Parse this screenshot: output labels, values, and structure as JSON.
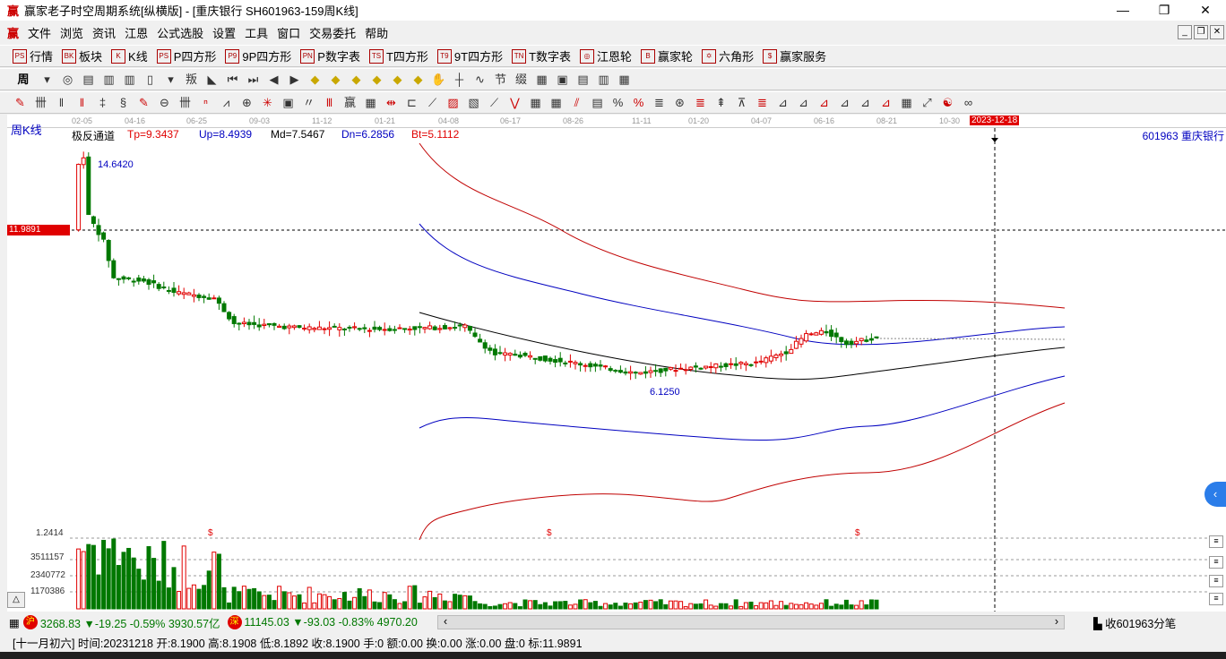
{
  "title": "赢家老子时空周期系统[纵横版] - [重庆银行  SH601963-159周K线]",
  "logo": "赢",
  "window_buttons": [
    "—",
    "❐",
    "✕"
  ],
  "menu": [
    "文件",
    "浏览",
    "资讯",
    "江恩",
    "公式选股",
    "设置",
    "工具",
    "窗口",
    "交易委托",
    "帮助"
  ],
  "toolbar1": [
    {
      "icon": "PS",
      "label": "行情"
    },
    {
      "icon": "BK",
      "label": "板块"
    },
    {
      "icon": "K",
      "label": "K线"
    },
    {
      "icon": "PS",
      "label": "P四方形"
    },
    {
      "icon": "P9",
      "label": "9P四方形"
    },
    {
      "icon": "PN",
      "label": "P数字表"
    },
    {
      "icon": "TS",
      "label": "T四方形"
    },
    {
      "icon": "T9",
      "label": "9T四方形"
    },
    {
      "icon": "TN",
      "label": "T数字表"
    },
    {
      "icon": "◎",
      "label": "江恩轮"
    },
    {
      "icon": "B",
      "label": "赢家轮"
    },
    {
      "icon": "✡",
      "label": "六角形"
    },
    {
      "icon": "$",
      "label": "赢家服务"
    }
  ],
  "period_select": "周",
  "axis_dates": [
    "02-05",
    "04-16",
    "06-25",
    "09-03",
    "11-12",
    "01-21",
    "04-08",
    "06-17",
    "08-26",
    "11-11",
    "01-20",
    "04-07",
    "06-16",
    "08-21",
    "10-30"
  ],
  "cursor_date": "2023-12-18",
  "period_label": "周K线",
  "indicator": {
    "name": "极反通道",
    "tp": "Tp=9.3437",
    "up": "Up=8.4939",
    "md": "Md=7.5467",
    "dn": "Dn=6.2856",
    "bt": "Bt=5.1112"
  },
  "stock_label": "601963 重庆银行",
  "high_label": "14.6420",
  "low_label": "6.1250",
  "cursor_price": "11.9891",
  "price_path": [
    [
      0,
      12.0
    ],
    [
      1,
      14.3
    ],
    [
      2,
      14.6
    ],
    [
      3,
      12.5
    ],
    [
      6,
      11.6
    ],
    [
      8,
      10.3
    ],
    [
      14,
      10.2
    ],
    [
      20,
      9.8
    ],
    [
      28,
      9.6
    ],
    [
      32,
      8.7
    ],
    [
      45,
      8.55
    ],
    [
      60,
      8.5
    ],
    [
      72,
      8.55
    ],
    [
      78,
      8.6
    ],
    [
      80,
      8.2
    ],
    [
      84,
      7.6
    ],
    [
      88,
      7.6
    ],
    [
      100,
      7.3
    ],
    [
      112,
      6.95
    ],
    [
      120,
      7.1
    ],
    [
      128,
      7.2
    ],
    [
      136,
      7.3
    ],
    [
      142,
      7.7
    ],
    [
      146,
      8.3
    ],
    [
      150,
      8.4
    ],
    [
      154,
      8.0
    ],
    [
      160,
      8.2
    ]
  ],
  "volume_axis": [
    "1.2414",
    "3511157",
    "2340772",
    "1170386"
  ],
  "dollar_marks": [
    "$",
    "$",
    "$"
  ],
  "index_bar": {
    "sh_badge": "沪",
    "sh": "3268.83 ▼-19.25 -0.59% 3930.57亿",
    "sz_badge": "深",
    "sz": "11145.03 ▼-93.03 -0.83% 4970.20",
    "right": "收601963分笔"
  },
  "status": "[十一月初六] 时间:20231218 开:8.1900 高:8.1908 低:8.1892 收:8.1900 手:0 额:0.00 换:0.00 涨:0.00 盘:0 标:11.9891",
  "colors": {
    "up": "#e00000",
    "down": "#007800",
    "blue": "#0000c0"
  }
}
